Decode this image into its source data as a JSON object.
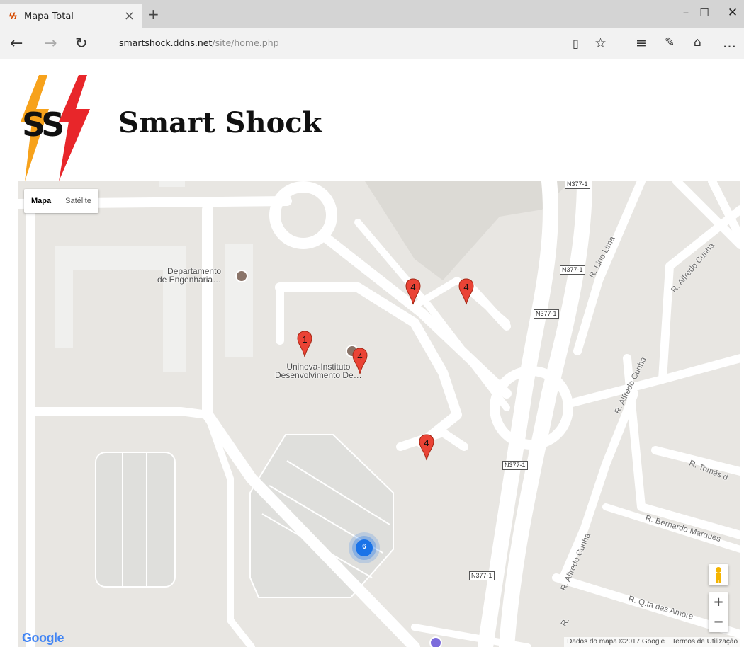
{
  "browser": {
    "tab_title": "Mapa Total",
    "url_host": "smartshock.ddns.net",
    "url_path": "/site/home.php"
  },
  "header": {
    "logo_letters": "SS",
    "site_title": "Smart Shock"
  },
  "map": {
    "map_type": {
      "map": "Mapa",
      "satellite": "Satélite",
      "selected": "Mapa"
    },
    "pois": [
      {
        "label_line1": "Departamento",
        "label_line2": "de Engenharia…"
      },
      {
        "label_line1": "Uninova-Instituto",
        "label_line2": "Desenvolvimento De…"
      }
    ],
    "streets": [
      "R. Lino Lima",
      "R. Alfredo Cunha",
      "R. Alfredo Cunha",
      "R. Tomás d",
      "R. Bernardo Marques",
      "R. Alfredo Cunha",
      "R. Q.ta das Amore",
      "R."
    ],
    "road_shields": [
      "N377-1",
      "N377-1",
      "N377-1",
      "N377-1",
      "N377-1"
    ],
    "markers": [
      "4",
      "4",
      "1",
      "4",
      "4"
    ],
    "cluster_count": "6",
    "zoom_in": "+",
    "zoom_out": "−",
    "logo": "Google",
    "attribution": "Dados do mapa ©2017 Google",
    "terms": "Termos de Utilização",
    "colors": {
      "marker": "#ea4335",
      "cluster": "#1a73e8",
      "logo_orange": "#f7a21b",
      "logo_red": "#e8262a"
    }
  }
}
